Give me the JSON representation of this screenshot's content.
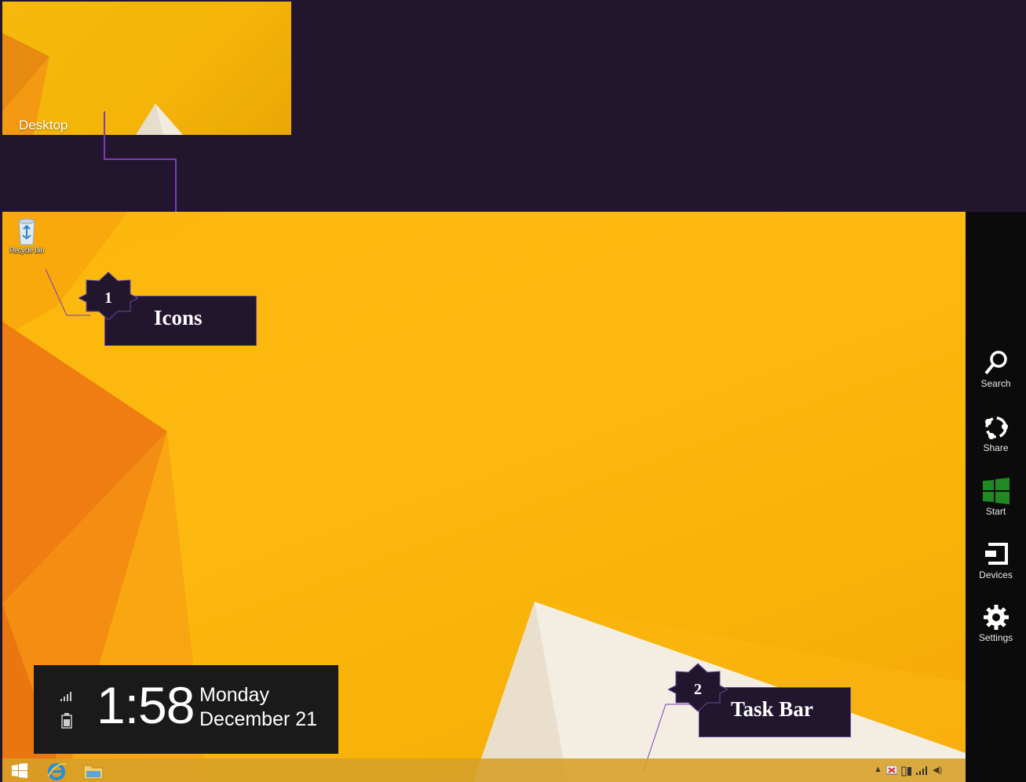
{
  "desktop_tile": {
    "label": "Desktop"
  },
  "desktop_icons": [
    {
      "label": "Recycle Bin",
      "icon": "recycle-bin-icon"
    }
  ],
  "callouts": [
    {
      "number": "1",
      "text": "Icons"
    },
    {
      "number": "2",
      "text": "Task Bar"
    }
  ],
  "clock": {
    "time": "1:58",
    "day": "Monday",
    "date": "December 21"
  },
  "charms": [
    {
      "label": "Search",
      "icon": "search-icon"
    },
    {
      "label": "Share",
      "icon": "share-icon"
    },
    {
      "label": "Start",
      "icon": "windows-logo-icon"
    },
    {
      "label": "Devices",
      "icon": "devices-icon"
    },
    {
      "label": "Settings",
      "icon": "gear-icon"
    }
  ],
  "taskbar": {
    "apps": [
      {
        "name": "start",
        "icon": "windows-logo-icon"
      },
      {
        "name": "internet-explorer",
        "icon": "internet-explorer-icon"
      },
      {
        "name": "file-explorer",
        "icon": "folder-icon"
      }
    ],
    "tray_icons": [
      "chevron-up-icon",
      "action-center-icon",
      "battery-icon",
      "signal-icon",
      "volume-icon"
    ]
  },
  "colors": {
    "background": "#22162f",
    "desktop": "#fdb910",
    "charms": "#0b0b0b",
    "callout_border": "#6a4a9a",
    "connector": "#7a3fb8"
  }
}
